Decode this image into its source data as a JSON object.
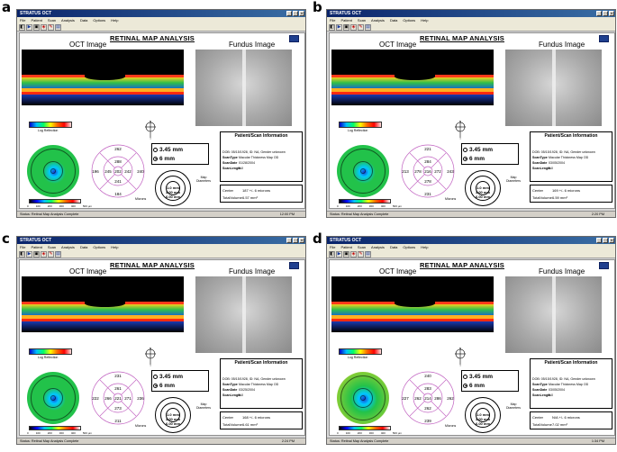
{
  "panels": [
    {
      "letter": "a",
      "window_title": "STRATUS OCT",
      "menu": [
        "File",
        "Patient",
        "Scan",
        "Analysis",
        "Data",
        "Options",
        "Help"
      ],
      "report_title": "RETINAL MAP ANALYSIS",
      "oct_label": "OCT Image",
      "fundus_label": "Fundus Image",
      "log_reflection": "Log Reflection",
      "scan_option_1": "3.45 mm",
      "scan_option_2": "6 mm",
      "selected_option": 2,
      "sectors": {
        "top_outer": "262",
        "top_inner": "288",
        "left_outer": "196",
        "left_inner": "245",
        "center": "202",
        "right_inner": "242",
        "right_outer": "240",
        "bottom_inner": "241",
        "bottom_outer": "184"
      },
      "diameters": [
        "1.0 mm",
        "3.00 mm",
        "6.00 mm"
      ],
      "map_diameters": "Map Diameters",
      "microns_label": "Microns",
      "info_title": "Patient/Scan Information",
      "dob_line": "DOB: 05/15/1928, ID: NA, Gender unknown",
      "scan_type": "Macular Thickness Map OD",
      "scan_date": "01/28/2004",
      "scan_length": "6.0",
      "center": "187 +/- 6 microns",
      "total_volume": "6.57 mm³",
      "status": "Status: Retinal Map Analysis Complete",
      "time": "12:00 PM"
    },
    {
      "letter": "b",
      "window_title": "STRATUS OCT",
      "menu": [
        "File",
        "Patient",
        "Scan",
        "Analysis",
        "Data",
        "Options",
        "Help"
      ],
      "report_title": "RETINAL MAP ANALYSIS",
      "oct_label": "OCT Image",
      "fundus_label": "Fundus Image",
      "log_reflection": "Log Reflection",
      "scan_option_1": "3.45 mm",
      "scan_option_2": "6 mm",
      "selected_option": 2,
      "sectors": {
        "top_outer": "221",
        "top_inner": "284",
        "left_outer": "213",
        "left_inner": "278",
        "center": "216",
        "right_inner": "272",
        "right_outer": "243",
        "bottom_inner": "278",
        "bottom_outer": "231"
      },
      "diameters": [
        "1.0 mm",
        "3.00 mm",
        "6.00 mm"
      ],
      "map_diameters": "Map Diameters",
      "microns_label": "Microns",
      "info_title": "Patient/Scan Information",
      "dob_line": "DOB: 05/15/1928, ID: NA, Gender unknown",
      "scan_type": "Macular Thickness Map OD",
      "scan_date": "03/05/2004",
      "scan_length": "6.0",
      "center": "169 +/- 6 microns",
      "total_volume": "6.59 mm³",
      "status": "Status: Retinal Map Analysis Complete",
      "time": "2:20 PM"
    },
    {
      "letter": "c",
      "window_title": "STRATUS OCT",
      "menu": [
        "File",
        "Patient",
        "Scan",
        "Analysis",
        "Data",
        "Options",
        "Help"
      ],
      "report_title": "RETINAL MAP ANALYSIS",
      "oct_label": "OCT Image",
      "fundus_label": "Fundus Image",
      "log_reflection": "Log Reflection",
      "scan_option_1": "3.45 mm",
      "scan_option_2": "6 mm",
      "selected_option": 2,
      "sectors": {
        "top_outer": "231",
        "top_inner": "261",
        "left_outer": "222",
        "left_inner": "266",
        "center": "221",
        "right_inner": "271",
        "right_outer": "236",
        "bottom_inner": "273",
        "bottom_outer": "211"
      },
      "diameters": [
        "1.0 mm",
        "3.00 mm",
        "6.00 mm"
      ],
      "map_diameters": "Map Diameters",
      "microns_label": "Microns",
      "info_title": "Patient/Scan Information",
      "dob_line": "DOB: 05/15/1928, ID: NA, Gender unknown",
      "scan_type": "Macular Thickness Map OD",
      "scan_date": "03/25/2004",
      "scan_length": "6.0",
      "center": "168 +/- 6 microns",
      "total_volume": "6.61 mm³",
      "status": "Status: Retinal Map Analysis Complete",
      "time": "2:24 PM"
    },
    {
      "letter": "d",
      "window_title": "STRATUS OCT",
      "menu": [
        "File",
        "Patient",
        "Scan",
        "Analysis",
        "Data",
        "Options",
        "Help"
      ],
      "report_title": "RETINAL MAP ANALYSIS",
      "oct_label": "OCT Image",
      "fundus_label": "Fundus Image",
      "log_reflection": "Log Reflection",
      "scan_option_1": "3.45 mm",
      "scan_option_2": "6 mm",
      "selected_option": 2,
      "sectors": {
        "top_outer": "240",
        "top_inner": "283",
        "left_outer": "227",
        "left_inner": "262",
        "center": "214",
        "right_inner": "286",
        "right_outer": "262",
        "bottom_inner": "262",
        "bottom_outer": "239"
      },
      "diameters": [
        "1.0 mm",
        "3.00 mm",
        "6.00 mm"
      ],
      "map_diameters": "Map Diameters",
      "microns_label": "Microns",
      "info_title": "Patient/Scan Information",
      "dob_line": "DOB: 05/15/1928, ID: NA, Gender unknown",
      "scan_type": "Macular Thickness Map OD",
      "scan_date": "03/05/2004",
      "scan_length": "6.0",
      "center": "N/A +/- 6 microns",
      "total_volume": "7.02 mm³",
      "status": "Status: Retinal Map Analysis Complete",
      "time": "1:34 PM"
    }
  ],
  "scale_ticks": [
    "0",
    "100",
    "200",
    "300",
    "400",
    "500 µm"
  ],
  "info_keys": {
    "scan_type": "ScanType",
    "scan_date": "ScanDate",
    "scan_length": "ScanLength",
    "center": "Center",
    "total_volume": "TotalVolume"
  },
  "colors": {
    "titlebar": "#0a246a",
    "sector_ring": "#c060c0",
    "map_green": "#22c24a"
  }
}
